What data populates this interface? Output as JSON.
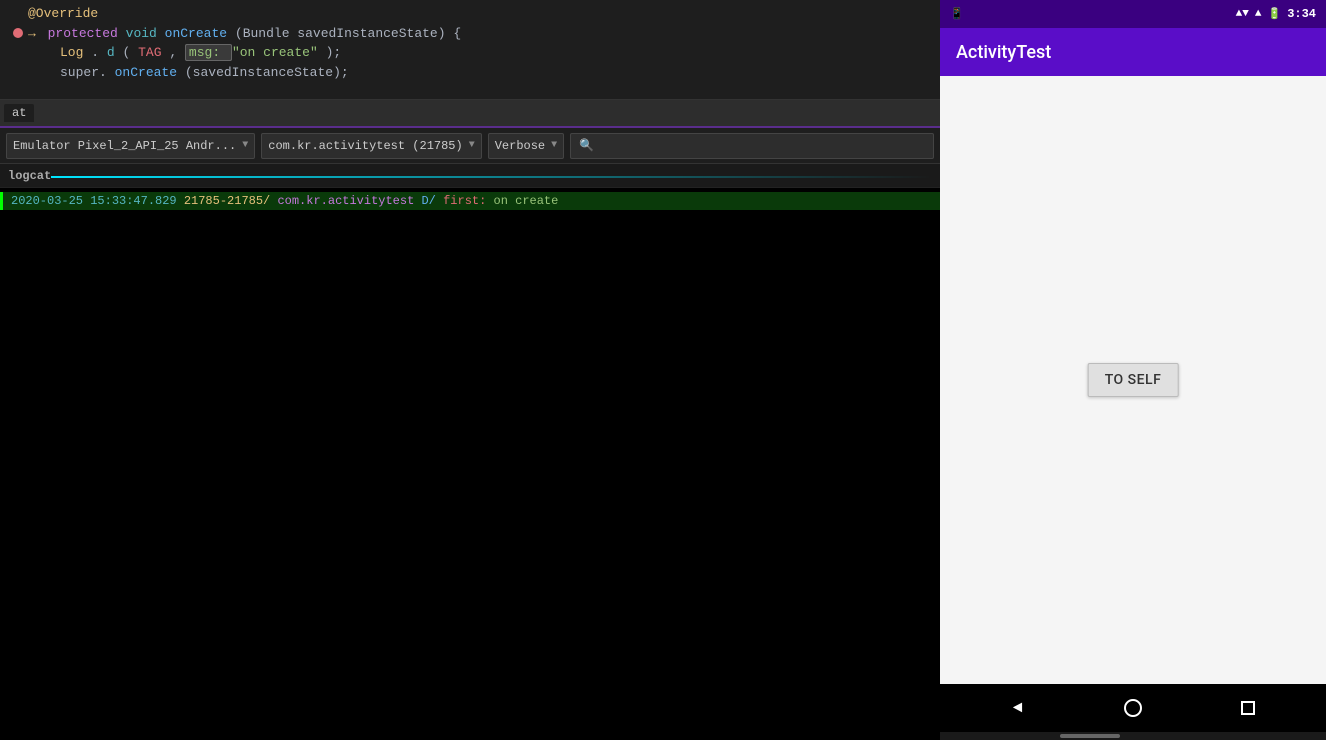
{
  "ide": {
    "code": {
      "lines": [
        {
          "lineNum": "",
          "hasBreakpoint": false,
          "hasDebugArrow": false,
          "parts": [
            {
              "type": "annotation",
              "text": "@Override"
            }
          ]
        },
        {
          "lineNum": "",
          "hasBreakpoint": true,
          "hasDebugArrow": true,
          "parts": [
            {
              "type": "modifier",
              "text": "protected "
            },
            {
              "type": "type",
              "text": "void "
            },
            {
              "type": "method",
              "text": "onCreate"
            },
            {
              "type": "normal",
              "text": "(Bundle savedInstanceState) {"
            }
          ]
        },
        {
          "lineNum": "",
          "hasBreakpoint": false,
          "hasDebugArrow": false,
          "parts": [
            {
              "type": "indent",
              "text": "        "
            },
            {
              "type": "static-method",
              "text": "Log"
            },
            {
              "type": "normal",
              "text": "."
            },
            {
              "type": "log-method",
              "text": "d"
            },
            {
              "type": "normal",
              "text": "("
            },
            {
              "type": "tag",
              "text": "TAG"
            },
            {
              "type": "normal",
              "text": ", "
            },
            {
              "type": "msg-box",
              "text": "\"on create\""
            },
            {
              "type": "normal",
              "text": ");"
            }
          ]
        },
        {
          "lineNum": "",
          "hasBreakpoint": false,
          "hasDebugArrow": false,
          "parts": [
            {
              "type": "indent",
              "text": "        "
            },
            {
              "type": "normal",
              "text": "super."
            },
            {
              "type": "method",
              "text": "onCreate"
            },
            {
              "type": "normal",
              "text": "(savedInstanceState);"
            }
          ]
        }
      ]
    },
    "logcat": {
      "title": "logcat",
      "device_selector": "Emulator Pixel_2_API_25 Andr...",
      "package_selector": "com.kr.activitytest (21785)",
      "level_selector": "Verbose",
      "search_placeholder": "🔍",
      "log_line": "2020-03-25 15:33:47.829 21785-21785/com.kr.activitytest D/first: on create"
    }
  },
  "emulator": {
    "status_bar": {
      "time": "3:34",
      "wifi": "▲▼",
      "signal": "▲",
      "battery": "🔋"
    },
    "app_title": "ActivityTest",
    "to_self_button": "TO SELF",
    "nav": {
      "back": "◄",
      "home": "",
      "recents": ""
    }
  }
}
